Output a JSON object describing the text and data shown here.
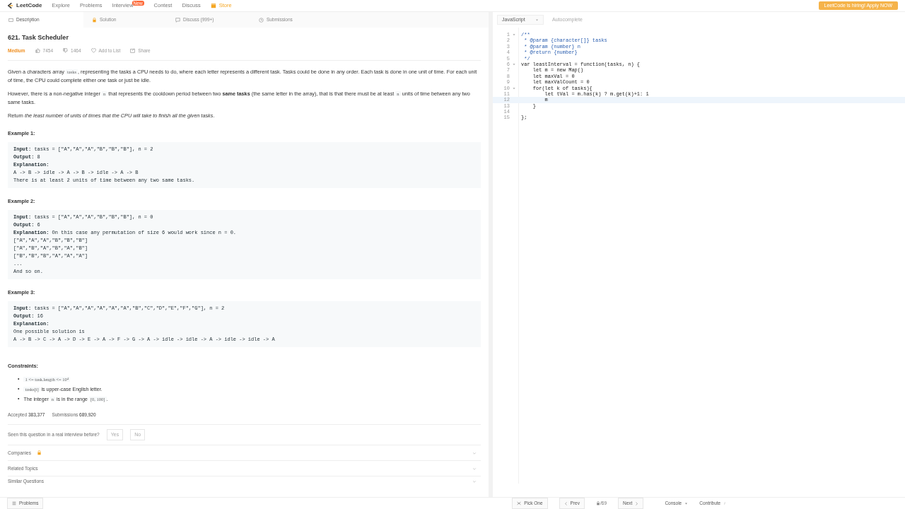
{
  "topnav": {
    "logo": "LeetCode",
    "links": [
      {
        "label": "Explore"
      },
      {
        "label": "Problems"
      },
      {
        "label": "Interview",
        "badge": "New"
      },
      {
        "label": "Contest"
      },
      {
        "label": "Discuss"
      },
      {
        "label": "Store",
        "kind": "store"
      }
    ],
    "banner": "LeetCode is hiring! Apply NOW"
  },
  "tabs": [
    {
      "label": "Description",
      "selected": true
    },
    {
      "label": "Solution",
      "selected": false
    },
    {
      "label": "Discuss (999+)",
      "selected": false
    },
    {
      "label": "Submissions",
      "selected": false
    }
  ],
  "problem": {
    "title": "621. Task Scheduler",
    "difficulty": "Medium",
    "likes": "7454",
    "dislikes": "1464",
    "actions": [
      "Add to List",
      "Share"
    ]
  },
  "description": [
    [
      {
        "kind": "text",
        "text": "Given a characters array "
      },
      {
        "kind": "code",
        "text": "tasks"
      },
      {
        "kind": "text",
        "text": ", representing the tasks a CPU needs to do, where each letter represents a different task. Tasks could be done in any order. Each task is done in one unit of time. For each unit of time, the CPU could complete either one task or just be idle."
      }
    ],
    [
      {
        "kind": "text",
        "text": "However, there is a non-negative integer "
      },
      {
        "kind": "code",
        "text": "n"
      },
      {
        "kind": "text",
        "text": " that represents the cooldown period between two "
      },
      {
        "kind": "bold",
        "text": "same tasks"
      },
      {
        "kind": "text",
        "text": " (the same letter in the array), that is that there must be at least "
      },
      {
        "kind": "code",
        "text": "n"
      },
      {
        "kind": "text",
        "text": " units of time between any two same tasks."
      }
    ],
    [
      {
        "kind": "text",
        "text": "Return "
      },
      {
        "kind": "italic",
        "text": "the least number of units of times that the CPU will take to finish all the given tasks"
      },
      {
        "kind": "text",
        "text": "."
      }
    ]
  ],
  "examples": [
    {
      "title": "Example 1:",
      "lines": [
        {
          "label": "Input:",
          "text": " tasks = [\"A\",\"A\",\"A\",\"B\",\"B\",\"B\"], n = 2"
        },
        {
          "label": "Output:",
          "text": " 8"
        },
        {
          "label": "Explanation:"
        },
        {
          "text": "A -> B -> idle -> A -> B -> idle -> A -> B"
        },
        {
          "text": "There is at least 2 units of time between any two same tasks."
        }
      ]
    },
    {
      "title": "Example 2:",
      "lines": [
        {
          "label": "Input:",
          "text": " tasks = [\"A\",\"A\",\"A\",\"B\",\"B\",\"B\"], n = 0"
        },
        {
          "label": "Output:",
          "text": " 6"
        },
        {
          "label": "Explanation:",
          "text": " On this case any permutation of size 6 would work since n = 0."
        },
        {
          "text": "[\"A\",\"A\",\"A\",\"B\",\"B\",\"B\"]"
        },
        {
          "text": "[\"A\",\"B\",\"A\",\"B\",\"A\",\"B\"]"
        },
        {
          "text": "[\"B\",\"B\",\"B\",\"A\",\"A\",\"A\"]"
        },
        {
          "text": "..."
        },
        {
          "text": "And so on."
        }
      ]
    },
    {
      "title": "Example 3:",
      "lines": [
        {
          "label": "Input:",
          "text": " tasks = [\"A\",\"A\",\"A\",\"A\",\"A\",\"A\",\"B\",\"C\",\"D\",\"E\",\"F\",\"G\"], n = 2"
        },
        {
          "label": "Output:",
          "text": " 16"
        },
        {
          "label": "Explanation:"
        },
        {
          "text": "One possible solution is"
        },
        {
          "text": "A -> B -> C -> A -> D -> E -> A -> F -> G -> A -> idle -> idle -> A -> idle -> idle -> A"
        }
      ]
    }
  ],
  "constraints": {
    "title": "Constraints:",
    "bullet": "•",
    "items": [
      [
        {
          "kind": "math",
          "text": "1 <= task.length <= 10$^{4}$"
        }
      ],
      [
        {
          "kind": "code",
          "text": "tasks[i]"
        },
        {
          "kind": "text",
          "text": " is upper-case English letter."
        }
      ],
      [
        {
          "kind": "text",
          "text": "The integer "
        },
        {
          "kind": "code",
          "text": "n"
        },
        {
          "kind": "text",
          "text": " is in the range "
        },
        {
          "kind": "code",
          "text": "[0, 100]"
        },
        {
          "kind": "text",
          "text": "."
        }
      ]
    ]
  },
  "stats": [
    {
      "label": "Accepted",
      "value": "383,377"
    },
    {
      "label": "Submissions",
      "value": "689,920"
    }
  ],
  "interview_question": {
    "text": "Seen this question in a real interview before?",
    "buttons": [
      "Yes",
      "No"
    ]
  },
  "sections": [
    {
      "label": "Companies",
      "locked": true
    },
    {
      "label": "Related Topics",
      "locked": false
    },
    {
      "label": "Similar Questions",
      "locked": false
    }
  ],
  "editor": {
    "language": "JavaScript",
    "autocomplete": "Autocomplete",
    "lines": [
      {
        "number": "1",
        "fold": true,
        "kind": "comment",
        "text": "/**",
        "active": false
      },
      {
        "number": "2",
        "fold": false,
        "kind": "comment",
        "text": " * @param {character[]} tasks",
        "active": false
      },
      {
        "number": "3",
        "fold": false,
        "kind": "comment",
        "text": " * @param {number} n",
        "active": false
      },
      {
        "number": "4",
        "fold": false,
        "kind": "comment",
        "text": " * @return {number}",
        "active": false
      },
      {
        "number": "5",
        "fold": false,
        "kind": "comment",
        "text": " */",
        "active": false
      },
      {
        "number": "6",
        "fold": true,
        "kind": "code",
        "text": "var leastInterval = function(tasks, n) {",
        "active": false
      },
      {
        "number": "7",
        "fold": false,
        "kind": "code",
        "text": "    let m = new Map()",
        "active": false
      },
      {
        "number": "8",
        "fold": false,
        "kind": "code",
        "text": "    let maxVal = 0",
        "active": false
      },
      {
        "number": "9",
        "fold": false,
        "kind": "code",
        "text": "    let maxValCount = 0",
        "active": false
      },
      {
        "number": "10",
        "fold": true,
        "kind": "code",
        "text": "    for(let k of tasks){",
        "active": false
      },
      {
        "number": "11",
        "fold": false,
        "kind": "code",
        "text": "        let tVal = m.has(k) ? m.get(k)+1: 1",
        "active": false
      },
      {
        "number": "12",
        "fold": false,
        "kind": "code",
        "text": "        m",
        "active": true
      },
      {
        "number": "13",
        "fold": false,
        "kind": "code",
        "text": "    }",
        "active": false
      },
      {
        "number": "14",
        "fold": false,
        "kind": "code",
        "active": false
      },
      {
        "number": "15",
        "fold": false,
        "kind": "code",
        "text": "};",
        "active": false
      }
    ]
  },
  "bottombar": {
    "problems": "Problems",
    "pick_one": "Pick One",
    "prev": "Prev",
    "counter": "/69",
    "next": "Next",
    "console": "Console",
    "contribute": "Contribute"
  }
}
